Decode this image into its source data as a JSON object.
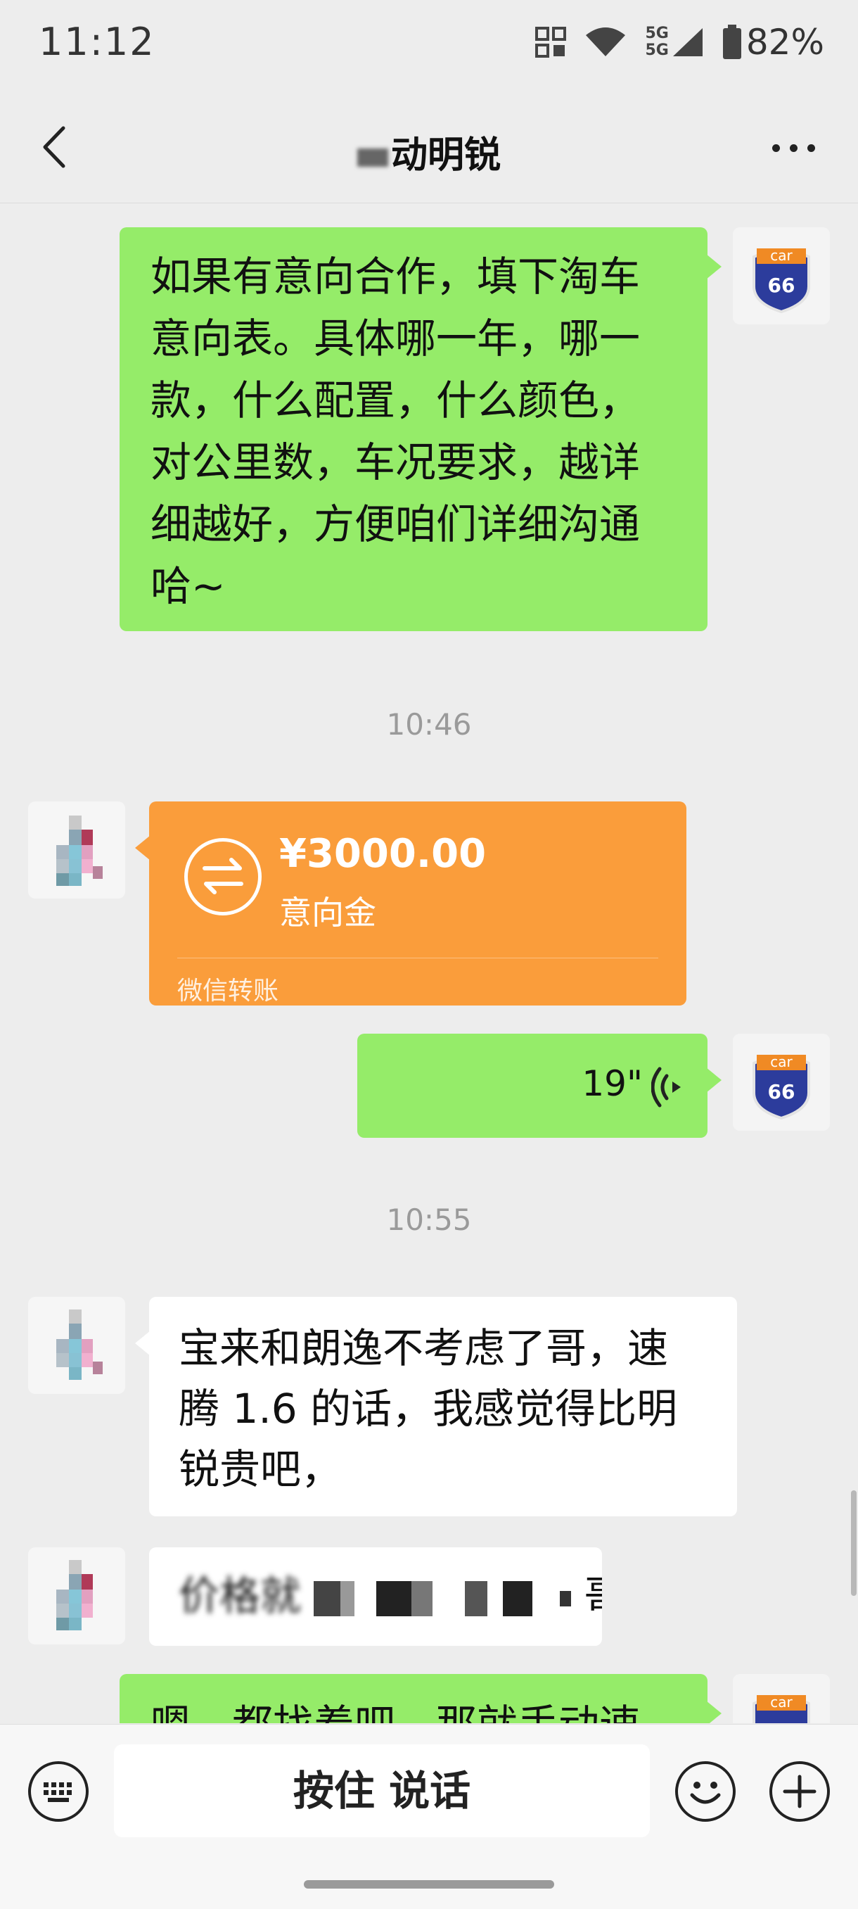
{
  "status_bar": {
    "time": "11:12",
    "network": "5G",
    "battery": "82%"
  },
  "header": {
    "title": "动明锐"
  },
  "messages": {
    "m1": {
      "lines": [
        "如果有意向合作，填下淘车",
        "意向表。具体哪一年，哪一",
        "款，什么配置，什么颜色，",
        "对公里数，车况要求，越详",
        "细越好，方便咱们详细沟通",
        "哈~"
      ]
    },
    "stamp1": "10:46",
    "transfer": {
      "amount": "¥3000.00",
      "note": "意向金",
      "footer": "微信转账"
    },
    "voice": {
      "duration": "19\""
    },
    "stamp2": "10:55",
    "m4": {
      "lines": [
        "宝来和朗逸不考虑了哥，速",
        "腾 1.6 的话，我感觉得比明",
        "锐贵吧，"
      ]
    },
    "m5": {
      "start": "价格就",
      "end": "哥"
    },
    "m6": {
      "line": "嗯，都找着吧，那就手动速"
    }
  },
  "avatar_car": {
    "top": "car",
    "number": "66"
  },
  "inputbar": {
    "hold_label": "按住 说话"
  },
  "colors": {
    "outgoing": "#95ec69",
    "incoming": "#ffffff",
    "transfer": "#fa9d3b",
    "background": "#ededed"
  }
}
